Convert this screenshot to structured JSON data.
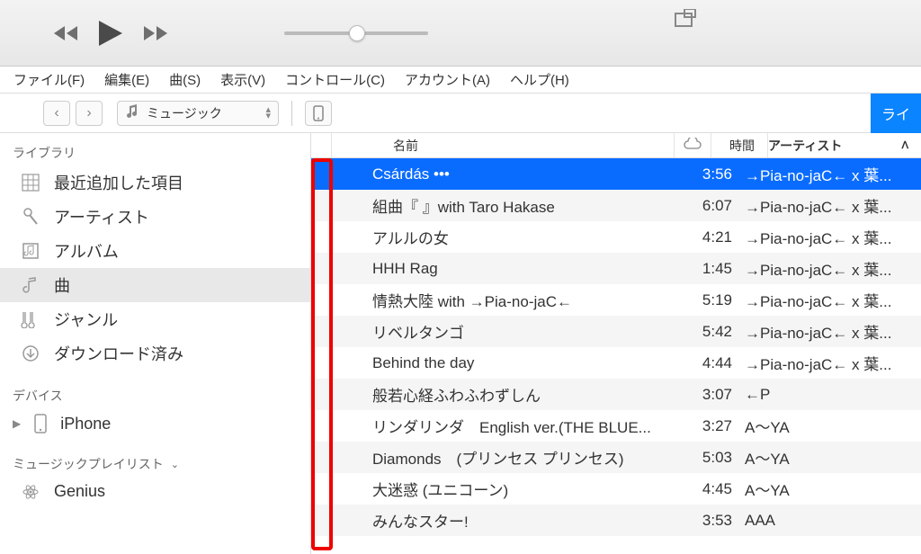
{
  "menubar": {
    "items": [
      "ファイル(F)",
      "編集(E)",
      "曲(S)",
      "表示(V)",
      "コントロール(C)",
      "アカウント(A)",
      "ヘルプ(H)"
    ]
  },
  "section_selector": {
    "label": "ミュージック"
  },
  "right_pill": {
    "label": "ライ"
  },
  "sidebar": {
    "library": {
      "header": "ライブラリ",
      "items": [
        {
          "icon": "grid",
          "label": "最近追加した項目"
        },
        {
          "icon": "mic",
          "label": "アーティスト"
        },
        {
          "icon": "album",
          "label": "アルバム"
        },
        {
          "icon": "note",
          "label": "曲",
          "active": true
        },
        {
          "icon": "guitar",
          "label": "ジャンル"
        },
        {
          "icon": "download",
          "label": "ダウンロード済み"
        }
      ]
    },
    "devices": {
      "header": "デバイス",
      "items": [
        {
          "icon": "iphone",
          "label": "iPhone"
        }
      ]
    },
    "playlists": {
      "header": "ミュージックプレイリスト",
      "items": [
        {
          "icon": "genius",
          "label": "Genius"
        }
      ]
    }
  },
  "columns": {
    "name": "名前",
    "time": "時間",
    "artist": "アーティスト"
  },
  "tracks": [
    {
      "name": "Csárdás •••",
      "time": "3:56",
      "artist": "→Pia-no-jaC← x 葉...",
      "selected": true
    },
    {
      "name": "組曲『 』with Taro Hakase",
      "time": "6:07",
      "artist": "→Pia-no-jaC← x 葉..."
    },
    {
      "name": "アルルの女",
      "time": "4:21",
      "artist": "→Pia-no-jaC← x 葉..."
    },
    {
      "name": "HHH Rag",
      "time": "1:45",
      "artist": "→Pia-no-jaC← x 葉..."
    },
    {
      "name": "情熱大陸 with →Pia-no-jaC←",
      "time": "5:19",
      "artist": "→Pia-no-jaC← x 葉..."
    },
    {
      "name": "リベルタンゴ",
      "time": "5:42",
      "artist": "→Pia-no-jaC← x 葉..."
    },
    {
      "name": "Behind the day",
      "time": "4:44",
      "artist": "→Pia-no-jaC← x 葉..."
    },
    {
      "name": "般若心経ふわふわずしん",
      "time": "3:07",
      "artist": "←P"
    },
    {
      "name": "リンダリンダ　English ver.(THE BLUE...",
      "time": "3:27",
      "artist": "A〜YA"
    },
    {
      "name": "Diamonds　(プリンセス プリンセス)",
      "time": "5:03",
      "artist": "A〜YA"
    },
    {
      "name": "大迷惑 (ユニコーン)",
      "time": "4:45",
      "artist": "A〜YA"
    },
    {
      "name": "みんなスター!",
      "time": "3:53",
      "artist": "AAA"
    }
  ]
}
